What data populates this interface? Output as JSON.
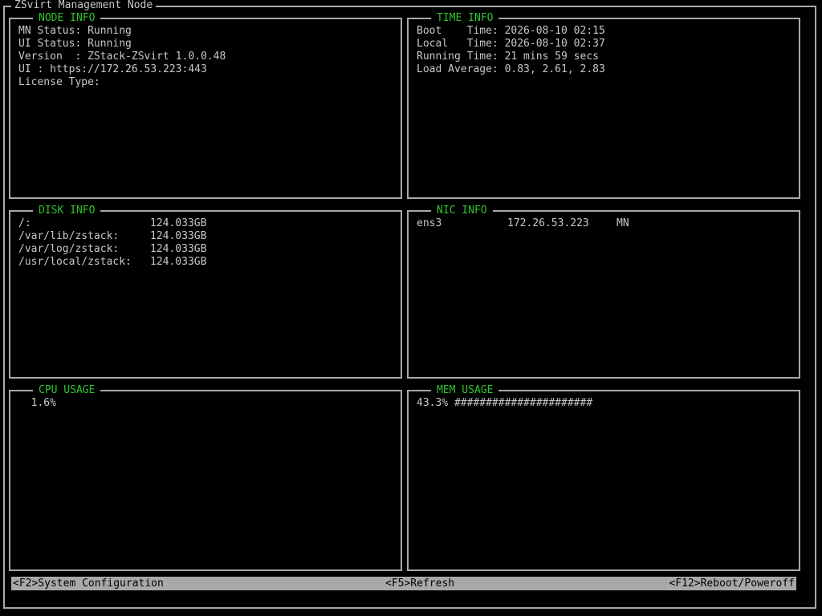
{
  "window": {
    "title": "ZSvirt Management Node"
  },
  "node_info": {
    "title": "NODE INFO",
    "lines": [
      "MN Status: Running",
      "UI Status: Running",
      "Version  : ZStack-ZSvirt 1.0.0.48",
      "UI : https://172.26.53.223:443",
      "License Type:"
    ]
  },
  "time_info": {
    "title": "TIME INFO",
    "lines": [
      "Boot    Time: 2026-08-10 02:15",
      "Local   Time: 2026-08-10 02:37",
      "Running Time: 21 mins 59 secs",
      "Load Average: 0.83, 2.61, 2.83"
    ]
  },
  "disk_info": {
    "title": "DISK INFO",
    "rows": [
      {
        "path": "/:",
        "size": "124.033GB"
      },
      {
        "path": "/var/lib/zstack:",
        "size": "124.033GB"
      },
      {
        "path": "/var/log/zstack:",
        "size": "124.033GB"
      },
      {
        "path": "/usr/local/zstack:",
        "size": "124.033GB"
      }
    ]
  },
  "nic_info": {
    "title": "NIC INFO",
    "rows": [
      {
        "name": "ens3",
        "ip": "172.26.53.223",
        "role": "MN"
      }
    ]
  },
  "cpu_usage": {
    "title": "CPU USAGE",
    "value": "  1.6%"
  },
  "mem_usage": {
    "title": "MEM USAGE",
    "value": "43.3% ######################"
  },
  "footer": {
    "left": "<F2>System Configuration",
    "center": "<F5>Refresh",
    "right": "<F12>Reboot/Poweroff"
  },
  "colors": {
    "title_green": "#2ec42e",
    "text": "#c8c8c8",
    "border": "#a8a8a8",
    "background": "#000000"
  }
}
